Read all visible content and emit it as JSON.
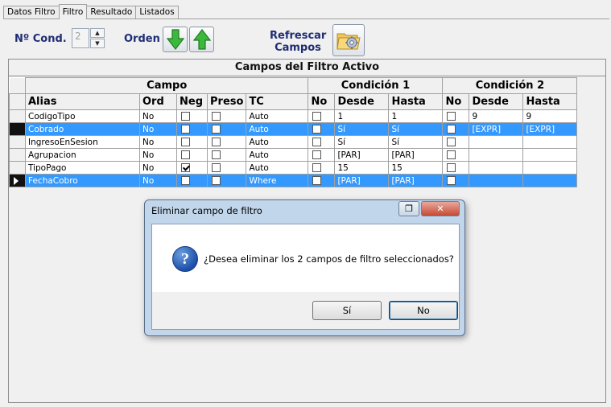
{
  "tabs": [
    {
      "label": "Datos Filtro"
    },
    {
      "label": "Filtro"
    },
    {
      "label": "Resultado"
    },
    {
      "label": "Listados"
    }
  ],
  "toolbar": {
    "ncond_label": "Nº Cond.",
    "ncond_value": "2",
    "orden_label": "Orden",
    "refresh_label_line1": "Refrescar",
    "refresh_label_line2": "Campos",
    "down_icon": "green-arrow-down-icon",
    "up_icon": "green-arrow-up-icon",
    "refresh_icon": "folder-gear-icon"
  },
  "panel": {
    "title": "Campos del Filtro Activo",
    "group_headers": {
      "campo": "Campo",
      "cond1": "Condición 1",
      "cond2": "Condición 2"
    },
    "columns": [
      "Alias",
      "Ord",
      "Neg",
      "Preso",
      "TC",
      "No",
      "Desde",
      "Hasta",
      "No",
      "Desde",
      "Hasta"
    ],
    "rows": [
      {
        "alias": "CodigoTipo",
        "ord": "No",
        "neg": false,
        "pres": false,
        "tc": "Auto",
        "no1": false,
        "desde1": "1",
        "hasta1": "1",
        "no2": false,
        "desde2": "9",
        "hasta2": "9",
        "selected": false,
        "current": false
      },
      {
        "alias": "Cobrado",
        "ord": "No",
        "neg": false,
        "pres": false,
        "tc": "Auto",
        "no1": false,
        "desde1": "Sí",
        "hasta1": "Sí",
        "no2": false,
        "desde2": "[EXPR]",
        "hasta2": "[EXPR]",
        "selected": true,
        "current": false
      },
      {
        "alias": "IngresoEnSesion",
        "ord": "No",
        "neg": false,
        "pres": false,
        "tc": "Auto",
        "no1": false,
        "desde1": "Sí",
        "hasta1": "Sí",
        "no2": false,
        "desde2": "",
        "hasta2": "",
        "selected": false,
        "current": false
      },
      {
        "alias": "Agrupacion",
        "ord": "No",
        "neg": false,
        "pres": false,
        "tc": "Auto",
        "no1": false,
        "desde1": "[PAR]",
        "hasta1": "[PAR]",
        "no2": false,
        "desde2": "",
        "hasta2": "",
        "selected": false,
        "current": false
      },
      {
        "alias": "TipoPago",
        "ord": "No",
        "neg": true,
        "pres": false,
        "tc": "Auto",
        "no1": false,
        "desde1": "15",
        "hasta1": "15",
        "no2": false,
        "desde2": "",
        "hasta2": "",
        "selected": false,
        "current": false
      },
      {
        "alias": "FechaCobro",
        "ord": "No",
        "neg": false,
        "pres": false,
        "tc": "Where",
        "no1": false,
        "desde1": "[PAR]",
        "hasta1": "[PAR]",
        "no2": false,
        "desde2": "",
        "hasta2": "",
        "selected": true,
        "current": true
      }
    ]
  },
  "dialog": {
    "title": "Eliminar campo de filtro",
    "message": "¿Desea eliminar los 2 campos de filtro seleccionados?",
    "icon": "question-icon",
    "yes_label": "Sí",
    "no_label": "No",
    "close_glyph": "✕",
    "restore_glyph": "❐"
  },
  "colors": {
    "selection": "#3399ff",
    "toolbar_label": "#1f2d73",
    "arrow_green": "#3cb93c"
  }
}
